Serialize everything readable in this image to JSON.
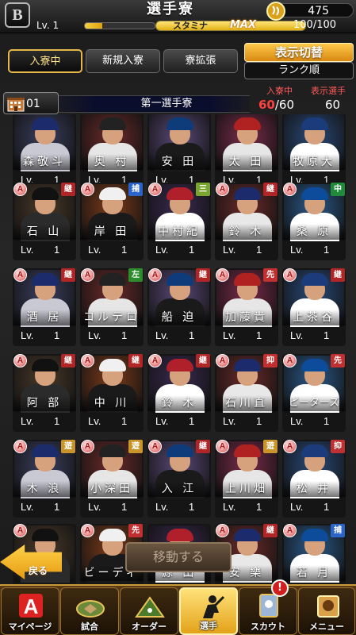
{
  "header": {
    "title": "選手寮",
    "coins": "475",
    "level_label": "Lv. 1",
    "stamina_label": "スタミナ",
    "stamina_max_label": "MAX",
    "stamina_value": "100/100",
    "stamina_fraction": 1.0,
    "logo_letter": "B"
  },
  "tabs": {
    "in_dorm": "入寮中",
    "new_entry": "新規入寮",
    "expand": "寮拡張",
    "display_switch": "表示切替",
    "sort_order": "ランク順"
  },
  "dorm": {
    "number": "01",
    "name": "第一選手寮",
    "in_dorm_label": "入寮中",
    "in_dorm_current": "60",
    "in_dorm_total": "/60",
    "display_label": "表示選手",
    "display_count": "60"
  },
  "players": [
    {
      "name": "森敬斗",
      "lv_label": "Lv.",
      "lv": "1",
      "rank": "",
      "pos": ""
    },
    {
      "name": "奥 村",
      "lv_label": "Lv.",
      "lv": "1",
      "rank": "",
      "pos": ""
    },
    {
      "name": "安 田",
      "lv_label": "Lv.",
      "lv": "1",
      "rank": "",
      "pos": ""
    },
    {
      "name": "太 田",
      "lv_label": "Lv.",
      "lv": "1",
      "rank": "",
      "pos": ""
    },
    {
      "name": "牧原大",
      "lv_label": "Lv.",
      "lv": "1",
      "rank": "",
      "pos": ""
    },
    {
      "name": "石 山",
      "lv_label": "Lv.",
      "lv": "1",
      "rank": "A",
      "pos": "継"
    },
    {
      "name": "岸 田",
      "lv_label": "Lv.",
      "lv": "1",
      "rank": "A",
      "pos": "捕"
    },
    {
      "name": "中村紀",
      "lv_label": "Lv.",
      "lv": "1",
      "rank": "A",
      "pos": "三"
    },
    {
      "name": "鈴 木",
      "lv_label": "Lv.",
      "lv": "1",
      "rank": "A",
      "pos": "継"
    },
    {
      "name": "桑 原",
      "lv_label": "Lv.",
      "lv": "1",
      "rank": "A",
      "pos": "中"
    },
    {
      "name": "酒 居",
      "lv_label": "Lv.",
      "lv": "1",
      "rank": "A",
      "pos": "継"
    },
    {
      "name": "コルテロ",
      "lv_label": "Lv.",
      "lv": "1",
      "rank": "A",
      "pos": "左"
    },
    {
      "name": "船 迫",
      "lv_label": "Lv.",
      "lv": "1",
      "rank": "A",
      "pos": "継"
    },
    {
      "name": "加藤貴",
      "lv_label": "Lv.",
      "lv": "1",
      "rank": "A",
      "pos": "先"
    },
    {
      "name": "上茶谷",
      "lv_label": "Lv.",
      "lv": "1",
      "rank": "A",
      "pos": "継"
    },
    {
      "name": "阿 部",
      "lv_label": "Lv.",
      "lv": "1",
      "rank": "A",
      "pos": "継"
    },
    {
      "name": "中 川",
      "lv_label": "Lv.",
      "lv": "1",
      "rank": "A",
      "pos": "継"
    },
    {
      "name": "鈴 木",
      "lv_label": "Lv.",
      "lv": "1",
      "rank": "A",
      "pos": "継"
    },
    {
      "name": "石川直",
      "lv_label": "Lv.",
      "lv": "1",
      "rank": "A",
      "pos": "抑"
    },
    {
      "name": "ピーターズ",
      "lv_label": "Lv.",
      "lv": "1",
      "rank": "A",
      "pos": "先"
    },
    {
      "name": "木 浪",
      "lv_label": "Lv.",
      "lv": "1",
      "rank": "A",
      "pos": "遊"
    },
    {
      "name": "小深田",
      "lv_label": "Lv.",
      "lv": "1",
      "rank": "A",
      "pos": "遊"
    },
    {
      "name": "入 江",
      "lv_label": "Lv.",
      "lv": "1",
      "rank": "A",
      "pos": "継"
    },
    {
      "name": "上川畑",
      "lv_label": "Lv.",
      "lv": "1",
      "rank": "A",
      "pos": "遊"
    },
    {
      "name": "松 井",
      "lv_label": "Lv.",
      "lv": "1",
      "rank": "A",
      "pos": "抑"
    },
    {
      "name": "",
      "lv_label": "",
      "lv": "",
      "rank": "A",
      "pos": ""
    },
    {
      "name": "ビーディ",
      "lv_label": "",
      "lv": "",
      "rank": "A",
      "pos": "先"
    },
    {
      "name": "源 田",
      "lv_label": "",
      "lv": "",
      "rank": "",
      "pos": ""
    },
    {
      "name": "安 樂",
      "lv_label": "",
      "lv": "",
      "rank": "A",
      "pos": "継"
    },
    {
      "name": "若 月",
      "lv_label": "",
      "lv": "",
      "rank": "A",
      "pos": "捕"
    }
  ],
  "actions": {
    "move": "移動する",
    "back": "戻る"
  },
  "nav": {
    "items": [
      {
        "label": "マイページ",
        "icon": "a-logo-icon"
      },
      {
        "label": "試合",
        "icon": "stadium-icon"
      },
      {
        "label": "オーダー",
        "icon": "field-icon"
      },
      {
        "label": "選手",
        "icon": "player-icon"
      },
      {
        "label": "スカウト",
        "icon": "scout-icon"
      },
      {
        "label": "メニュー",
        "icon": "menu-icon"
      }
    ],
    "badge": "!"
  },
  "colors": {
    "accent": "#e6b84a",
    "count_red": "#ff4040"
  }
}
